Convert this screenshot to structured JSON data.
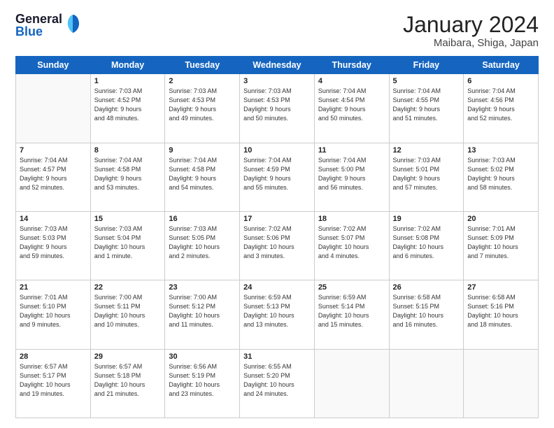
{
  "header": {
    "logo_general": "General",
    "logo_blue": "Blue",
    "month": "January 2024",
    "location": "Maibara, Shiga, Japan"
  },
  "days_of_week": [
    "Sunday",
    "Monday",
    "Tuesday",
    "Wednesday",
    "Thursday",
    "Friday",
    "Saturday"
  ],
  "weeks": [
    [
      {
        "day": "",
        "info": ""
      },
      {
        "day": "1",
        "info": "Sunrise: 7:03 AM\nSunset: 4:52 PM\nDaylight: 9 hours\nand 48 minutes."
      },
      {
        "day": "2",
        "info": "Sunrise: 7:03 AM\nSunset: 4:53 PM\nDaylight: 9 hours\nand 49 minutes."
      },
      {
        "day": "3",
        "info": "Sunrise: 7:03 AM\nSunset: 4:53 PM\nDaylight: 9 hours\nand 50 minutes."
      },
      {
        "day": "4",
        "info": "Sunrise: 7:04 AM\nSunset: 4:54 PM\nDaylight: 9 hours\nand 50 minutes."
      },
      {
        "day": "5",
        "info": "Sunrise: 7:04 AM\nSunset: 4:55 PM\nDaylight: 9 hours\nand 51 minutes."
      },
      {
        "day": "6",
        "info": "Sunrise: 7:04 AM\nSunset: 4:56 PM\nDaylight: 9 hours\nand 52 minutes."
      }
    ],
    [
      {
        "day": "7",
        "info": "Sunrise: 7:04 AM\nSunset: 4:57 PM\nDaylight: 9 hours\nand 52 minutes."
      },
      {
        "day": "8",
        "info": "Sunrise: 7:04 AM\nSunset: 4:58 PM\nDaylight: 9 hours\nand 53 minutes."
      },
      {
        "day": "9",
        "info": "Sunrise: 7:04 AM\nSunset: 4:58 PM\nDaylight: 9 hours\nand 54 minutes."
      },
      {
        "day": "10",
        "info": "Sunrise: 7:04 AM\nSunset: 4:59 PM\nDaylight: 9 hours\nand 55 minutes."
      },
      {
        "day": "11",
        "info": "Sunrise: 7:04 AM\nSunset: 5:00 PM\nDaylight: 9 hours\nand 56 minutes."
      },
      {
        "day": "12",
        "info": "Sunrise: 7:03 AM\nSunset: 5:01 PM\nDaylight: 9 hours\nand 57 minutes."
      },
      {
        "day": "13",
        "info": "Sunrise: 7:03 AM\nSunset: 5:02 PM\nDaylight: 9 hours\nand 58 minutes."
      }
    ],
    [
      {
        "day": "14",
        "info": "Sunrise: 7:03 AM\nSunset: 5:03 PM\nDaylight: 9 hours\nand 59 minutes."
      },
      {
        "day": "15",
        "info": "Sunrise: 7:03 AM\nSunset: 5:04 PM\nDaylight: 10 hours\nand 1 minute."
      },
      {
        "day": "16",
        "info": "Sunrise: 7:03 AM\nSunset: 5:05 PM\nDaylight: 10 hours\nand 2 minutes."
      },
      {
        "day": "17",
        "info": "Sunrise: 7:02 AM\nSunset: 5:06 PM\nDaylight: 10 hours\nand 3 minutes."
      },
      {
        "day": "18",
        "info": "Sunrise: 7:02 AM\nSunset: 5:07 PM\nDaylight: 10 hours\nand 4 minutes."
      },
      {
        "day": "19",
        "info": "Sunrise: 7:02 AM\nSunset: 5:08 PM\nDaylight: 10 hours\nand 6 minutes."
      },
      {
        "day": "20",
        "info": "Sunrise: 7:01 AM\nSunset: 5:09 PM\nDaylight: 10 hours\nand 7 minutes."
      }
    ],
    [
      {
        "day": "21",
        "info": "Sunrise: 7:01 AM\nSunset: 5:10 PM\nDaylight: 10 hours\nand 9 minutes."
      },
      {
        "day": "22",
        "info": "Sunrise: 7:00 AM\nSunset: 5:11 PM\nDaylight: 10 hours\nand 10 minutes."
      },
      {
        "day": "23",
        "info": "Sunrise: 7:00 AM\nSunset: 5:12 PM\nDaylight: 10 hours\nand 11 minutes."
      },
      {
        "day": "24",
        "info": "Sunrise: 6:59 AM\nSunset: 5:13 PM\nDaylight: 10 hours\nand 13 minutes."
      },
      {
        "day": "25",
        "info": "Sunrise: 6:59 AM\nSunset: 5:14 PM\nDaylight: 10 hours\nand 15 minutes."
      },
      {
        "day": "26",
        "info": "Sunrise: 6:58 AM\nSunset: 5:15 PM\nDaylight: 10 hours\nand 16 minutes."
      },
      {
        "day": "27",
        "info": "Sunrise: 6:58 AM\nSunset: 5:16 PM\nDaylight: 10 hours\nand 18 minutes."
      }
    ],
    [
      {
        "day": "28",
        "info": "Sunrise: 6:57 AM\nSunset: 5:17 PM\nDaylight: 10 hours\nand 19 minutes."
      },
      {
        "day": "29",
        "info": "Sunrise: 6:57 AM\nSunset: 5:18 PM\nDaylight: 10 hours\nand 21 minutes."
      },
      {
        "day": "30",
        "info": "Sunrise: 6:56 AM\nSunset: 5:19 PM\nDaylight: 10 hours\nand 23 minutes."
      },
      {
        "day": "31",
        "info": "Sunrise: 6:55 AM\nSunset: 5:20 PM\nDaylight: 10 hours\nand 24 minutes."
      },
      {
        "day": "",
        "info": ""
      },
      {
        "day": "",
        "info": ""
      },
      {
        "day": "",
        "info": ""
      }
    ]
  ]
}
